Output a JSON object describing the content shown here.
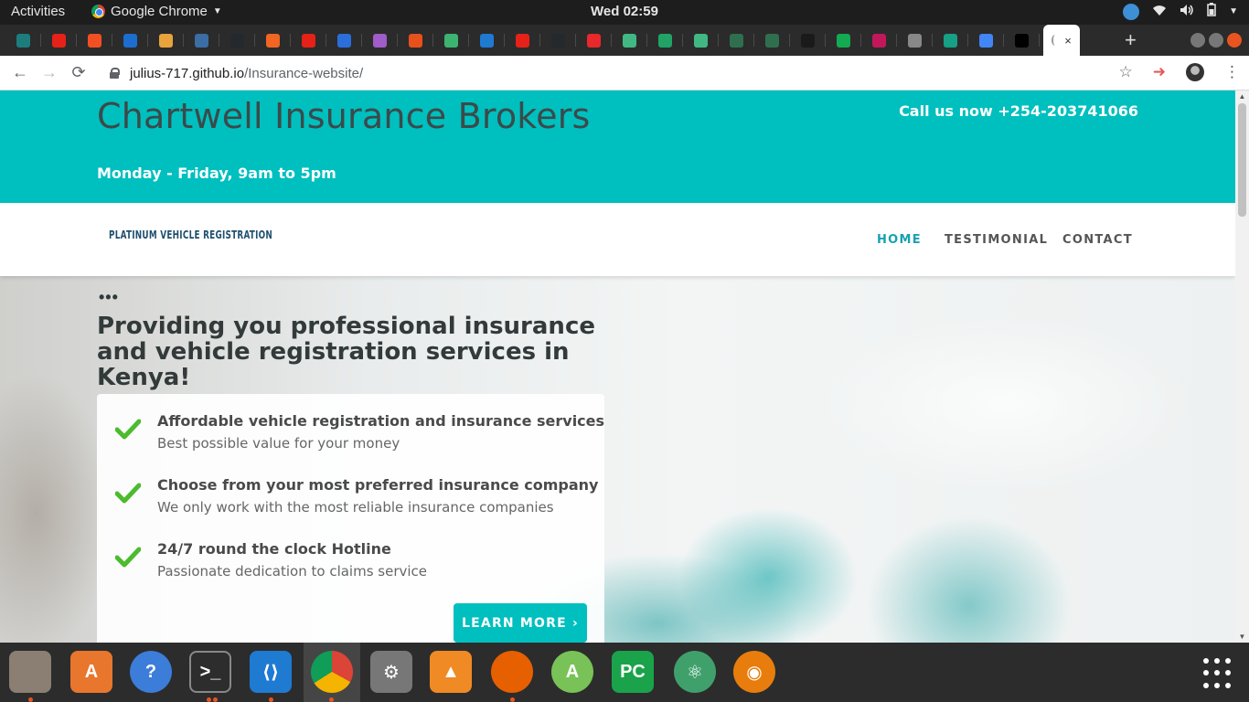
{
  "system": {
    "activities": "Activities",
    "app_name": "Google Chrome",
    "clock": "Wed 02:59"
  },
  "browser": {
    "url_host": "julius-717.github.io",
    "url_path": "/Insurance-website/",
    "active_tab_close": "×",
    "new_tab": "+"
  },
  "site": {
    "brand": "Chartwell Insurance Brokers",
    "hours": "Monday - Friday, 9am to 5pm",
    "call": "Call us now +254-203741066",
    "logo": "PLATINUM VEHICLE REGISTRATION",
    "nav": {
      "home": "HOME",
      "testimonial": "TESTIMONIAL",
      "contact": "CONTACT"
    },
    "dots": "•••",
    "tagline": "Providing you professional insurance and vehicle registration services in Kenya!",
    "features": [
      {
        "title": "Affordable vehicle registration and insurance services",
        "subtitle": "Best possible value for your money"
      },
      {
        "title": "Choose from your most preferred insurance company",
        "subtitle": "We only work with the most reliable insurance companies"
      },
      {
        "title": "24/7 round the clock Hotline",
        "subtitle": "Passionate dedication to claims service"
      }
    ],
    "learn_more": "LEARN MORE ›"
  },
  "colors": {
    "brand_teal": "#00bfbf",
    "check_green": "#4cbb2e",
    "nav_active": "#17a2b0"
  }
}
